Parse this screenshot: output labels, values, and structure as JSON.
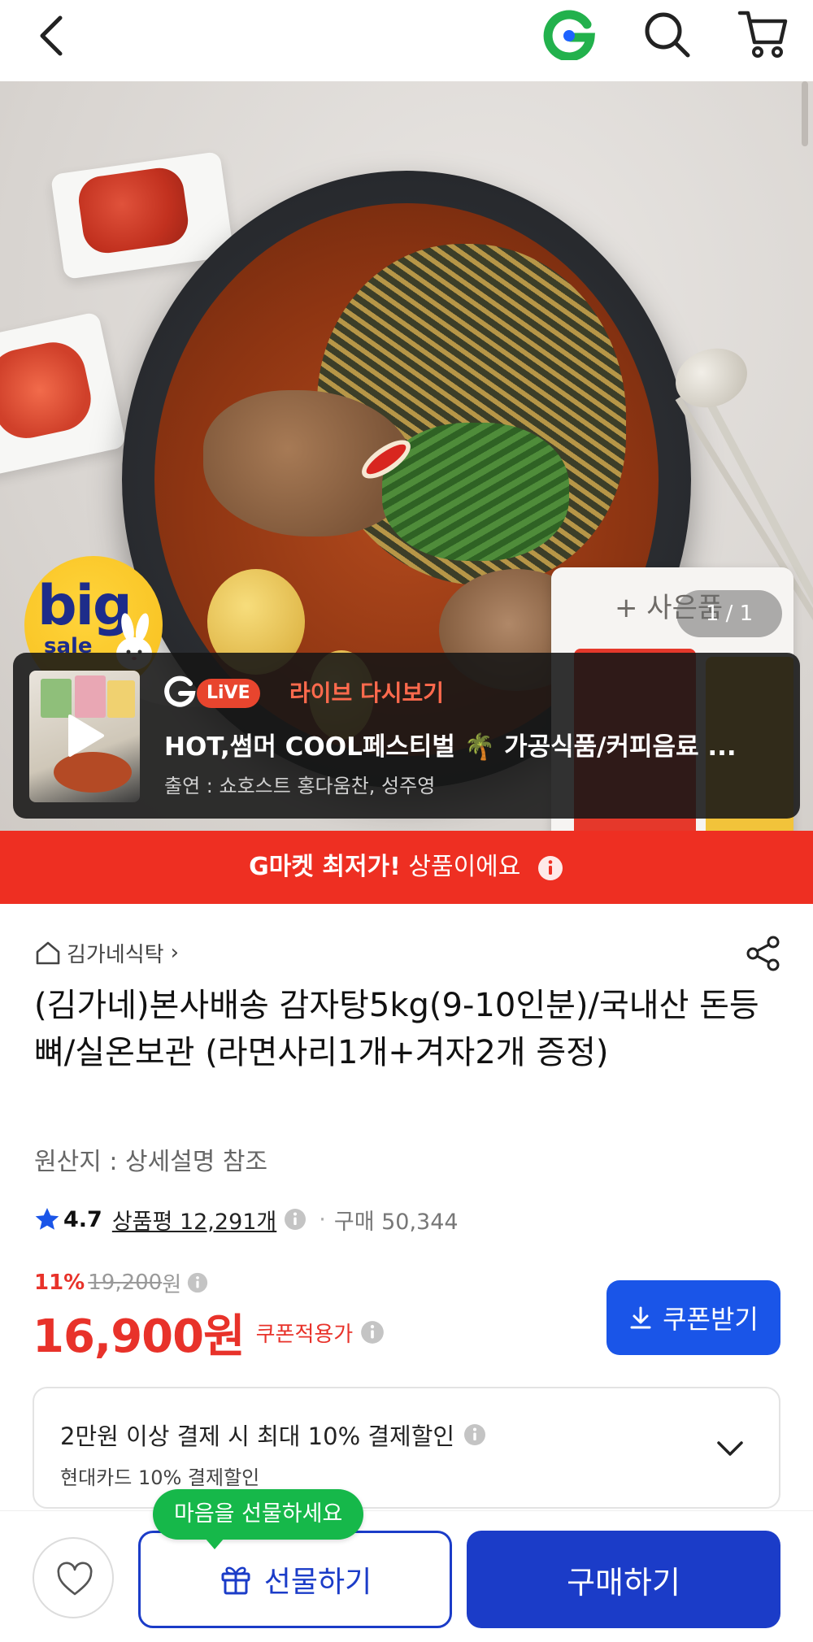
{
  "header": {
    "back_icon": "chevron-left-icon",
    "brand_icon": "gmarket-g-logo",
    "search_icon": "search-icon",
    "cart_icon": "cart-icon"
  },
  "hero": {
    "badge_big": "big",
    "badge_sale": "sale",
    "gift_label": "+ 사은품",
    "pager": "1 / 1"
  },
  "live": {
    "badge": "LiVE",
    "replay": "라이브 다시보기",
    "title": "HOT,썸머 COOL페스티벌 🌴 가공식품/커피음료 ...",
    "cast": "출연 : 쇼호스트 홍다움찬, 성주영"
  },
  "lowest_banner": {
    "strong": "G마켓 최저가!",
    "rest": " 상품이에요"
  },
  "product": {
    "store": "김가네식탁",
    "title": "(김가네)본사배송 감자탕5kg(9-10인분)/국내산 돈등뼈/실온보관 (라면사리1개+겨자2개 증정)",
    "origin": "원산지 : 상세설명 참조",
    "rating": "4.7",
    "reviews": "상품평 12,291개",
    "purchases": "구매 50,344",
    "discount": "11%",
    "original_price": "19,200",
    "original_price_unit": "원",
    "price": "16,900원",
    "coupon_price_label": "쿠폰적용가",
    "coupon_button": "쿠폰받기"
  },
  "promo": {
    "line1": "2만원 이상 결제 시 최대 10% 결제할인",
    "line2": "현대카드 10% 결제할인"
  },
  "bottom": {
    "tooltip": "마음을 선물하세요",
    "gift_button": "선물하기",
    "buy_button": "구매하기"
  },
  "colors": {
    "brand_blue": "#1b3cc8",
    "coupon_blue": "#1a55e8",
    "price_red": "#e8322a",
    "banner_red": "#ee2f22",
    "tooltip_green": "#16b84a"
  }
}
